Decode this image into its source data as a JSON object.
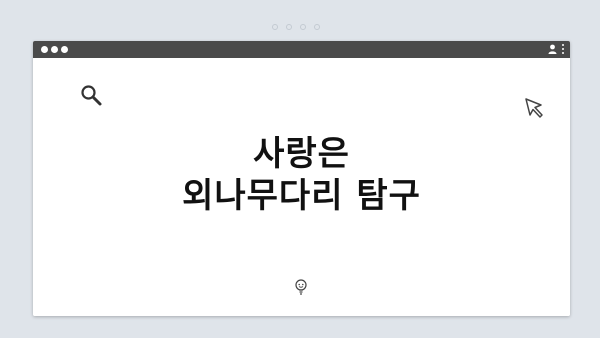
{
  "pager": {
    "dots": 4
  },
  "window": {
    "titlebar_color": "#4a4a4a",
    "icons": [
      "user-icon",
      "kebab-menu-icon"
    ]
  },
  "content": {
    "headline_line1": "사랑은",
    "headline_line2": "외나무다리 탐구",
    "icons": [
      "search-icon",
      "cursor-icon",
      "lightbulb-icon"
    ]
  },
  "colors": {
    "background": "#dfe4ea",
    "window": "#ffffff",
    "text": "#111111"
  }
}
